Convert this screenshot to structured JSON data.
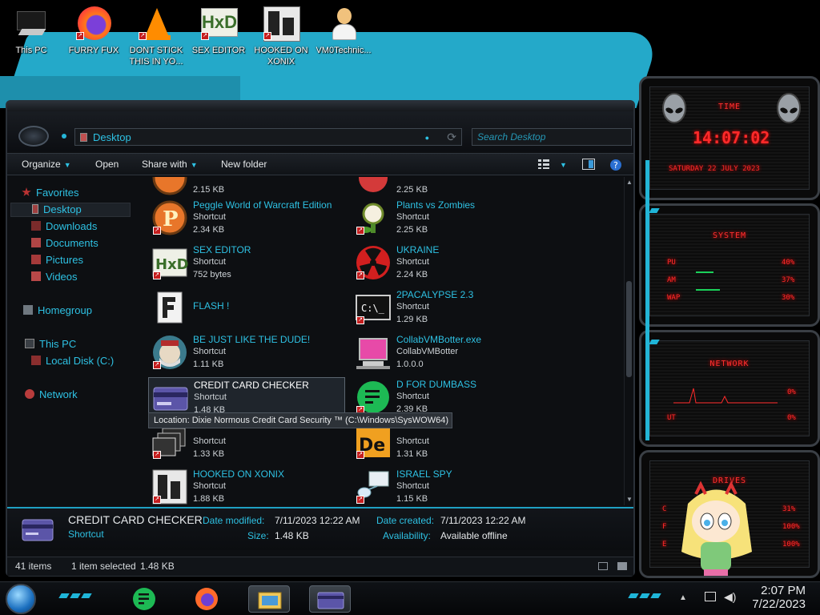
{
  "desktop": {
    "icons": [
      {
        "label": "This PC",
        "icon": "this-pc-icon"
      },
      {
        "label": "FURRY FUX",
        "icon": "firefox-icon"
      },
      {
        "label": "DONT STICK THIS IN YO...",
        "icon": "vlc-icon"
      },
      {
        "label": "SEX EDITOR",
        "icon": "hxd-icon"
      },
      {
        "label": "HOOKED ON XONIX",
        "icon": "xonix-icon"
      },
      {
        "label": "VM0Technic...",
        "icon": "user-icon"
      }
    ]
  },
  "explorer": {
    "address": "Desktop",
    "search_placeholder": "Search Desktop",
    "toolbar": {
      "organize": "Organize",
      "open": "Open",
      "share_with": "Share with",
      "new_folder": "New folder"
    },
    "nav": {
      "favorites": "Favorites",
      "desktop": "Desktop",
      "downloads": "Downloads",
      "documents": "Documents",
      "pictures": "Pictures",
      "videos": "Videos",
      "homegroup": "Homegroup",
      "this_pc": "This PC",
      "local_disk": "Local Disk (C:)",
      "network": "Network"
    },
    "files": [
      {
        "name": "",
        "type": "",
        "size": "2.15 KB",
        "icon": "peggle-icon"
      },
      {
        "name": "",
        "type": "",
        "size": "2.25 KB",
        "icon": "plant-icon"
      },
      {
        "name": "Peggle World of Warcraft Edition",
        "type": "Shortcut",
        "size": "2.34 KB",
        "icon": "peggle-icon"
      },
      {
        "name": "Plants vs Zombies",
        "type": "Shortcut",
        "size": "2.25 KB",
        "icon": "plant-icon"
      },
      {
        "name": "SEX EDITOR",
        "type": "Shortcut",
        "size": "752 bytes",
        "icon": "hxd-icon"
      },
      {
        "name": "UKRAINE",
        "type": "Shortcut",
        "size": "2.24 KB",
        "icon": "radiation-icon"
      },
      {
        "name": "FLASH !",
        "type": "",
        "size": "",
        "icon": "flash-icon"
      },
      {
        "name": "2PACALYPSE 2.3",
        "type": "Shortcut",
        "size": "1.29 KB",
        "icon": "console-icon"
      },
      {
        "name": "BE JUST LIKE THE DUDE!",
        "type": "Shortcut",
        "size": "1.11 KB",
        "icon": "dude-icon"
      },
      {
        "name": "CollabVMBotter.exe",
        "type": "CollabVMBotter",
        "size": "1.0.0.0",
        "icon": "collab-icon"
      },
      {
        "name": "CREDIT CARD CHECKER",
        "type": "Shortcut",
        "size": "1.48 KB",
        "icon": "credit-card-icon"
      },
      {
        "name": "D FOR DUMBASS",
        "type": "Shortcut",
        "size": "2.39 KB",
        "icon": "green-chat-icon"
      },
      {
        "name": "",
        "type": "Shortcut",
        "size": "1.33 KB",
        "icon": "windows-stack-icon"
      },
      {
        "name": "",
        "type": "Shortcut",
        "size": "1.31 KB",
        "icon": "de-icon"
      },
      {
        "name": "HOOKED ON XONIX",
        "type": "Shortcut",
        "size": "1.88 KB",
        "icon": "xonix-icon"
      },
      {
        "name": "ISRAEL SPY",
        "type": "Shortcut",
        "size": "1.15 KB",
        "icon": "network-share-icon"
      }
    ],
    "tooltip": "Location: Dixie Normous Credit Card Security ™ (C:\\Windows\\SysWOW64)",
    "details": {
      "name": "CREDIT CARD CHECKER",
      "type": "Shortcut",
      "date_modified_label": "Date modified:",
      "date_modified": "7/11/2023 12:22 AM",
      "size_label": "Size:",
      "size": "1.48 KB",
      "date_created_label": "Date created:",
      "date_created": "7/11/2023 12:22 AM",
      "availability_label": "Availability:",
      "availability": "Available offline"
    },
    "status": {
      "items": "41 items",
      "selected": "1 item selected",
      "selected_size": "1.48 KB"
    }
  },
  "gadgets": {
    "time": {
      "title": "TIME",
      "clock": "14:07:02",
      "date": "SATURDAY 22 JULY 2023"
    },
    "system": {
      "title": "SYSTEM",
      "rows": [
        {
          "label": "PU",
          "value": "40%"
        },
        {
          "label": "AM",
          "value": "37%"
        },
        {
          "label": "WAP",
          "value": "30%"
        }
      ]
    },
    "network": {
      "title": "NETWORK",
      "rows": [
        {
          "label": "",
          "value": "0%"
        },
        {
          "label": "UT",
          "value": "0%"
        }
      ]
    },
    "drives": {
      "title": "DRIVES",
      "rows": [
        {
          "label": "C",
          "value": "31%"
        },
        {
          "label": "F",
          "value": "100%"
        },
        {
          "label": "E",
          "value": "100%"
        }
      ]
    }
  },
  "taskbar": {
    "time": "2:07 PM",
    "date": "7/22/2023"
  },
  "colors": {
    "accent": "#2ec1e3",
    "gadget_red": "#ff2a2a"
  }
}
